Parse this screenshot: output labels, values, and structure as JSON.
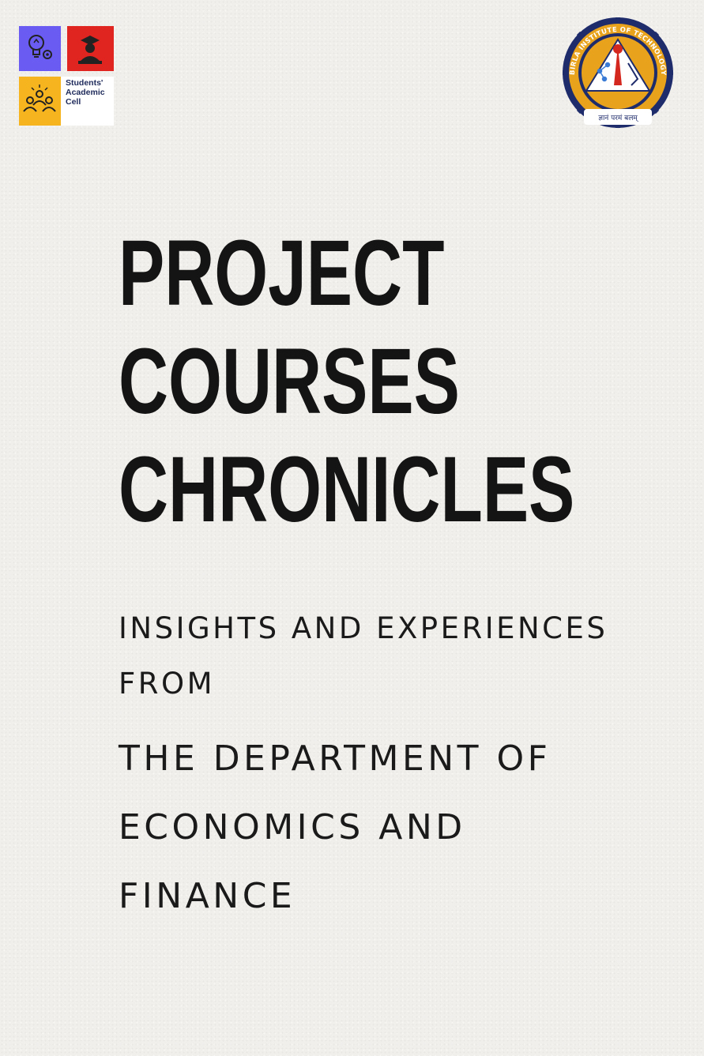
{
  "logos": {
    "cell_name": [
      "Students'",
      "Academic",
      "Cell"
    ],
    "emblem_ring_text": "BIRLA INSTITUTE OF TECHNOLOGY & SCIENCE, PILANI",
    "emblem_motto": "ज्ञानं परमं बलम्"
  },
  "title_lines": [
    "PROJECT",
    "COURSES",
    "CHRONICLES"
  ],
  "subtitle_lines": [
    "INSIGHTS AND EXPERIENCES",
    "FROM"
  ],
  "department_lines": [
    "THE DEPARTMENT OF",
    "ECONOMICS AND",
    "FINANCE"
  ],
  "colors": {
    "background": "#f1efeb",
    "text": "#141414",
    "tile_blue": "#6a5cf2",
    "tile_red": "#e0241f",
    "tile_yellow": "#f6b51e",
    "emblem_navy": "#1f2c6b",
    "emblem_gold": "#e8a21b"
  }
}
